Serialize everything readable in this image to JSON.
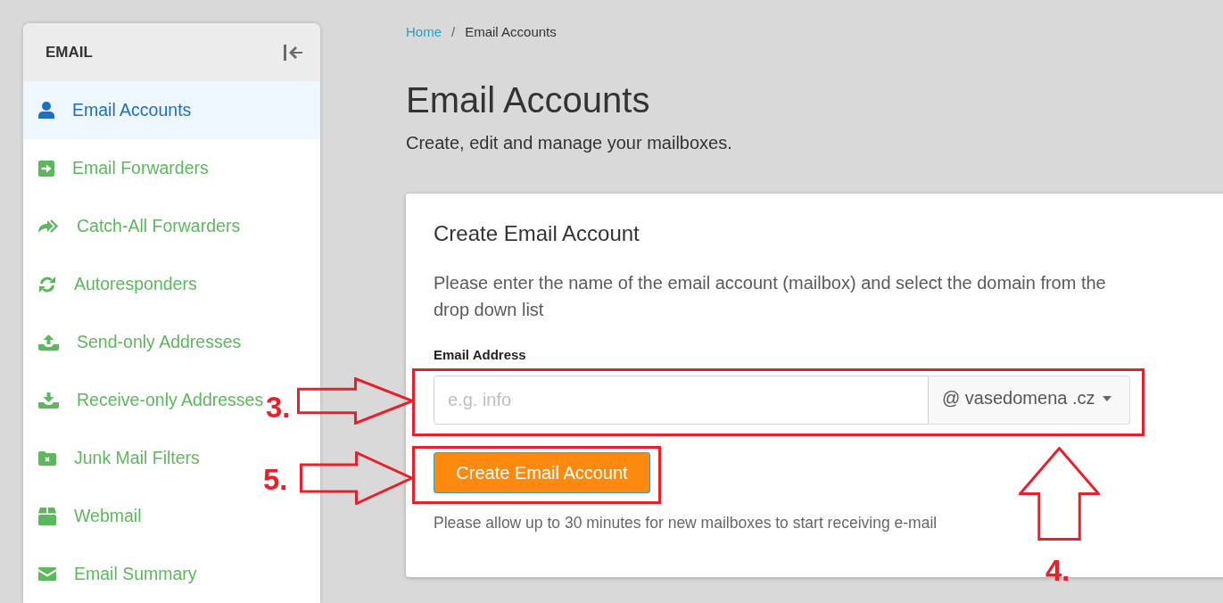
{
  "sidebar": {
    "title": "EMAIL",
    "items": [
      {
        "label": "Email Accounts",
        "selected": true,
        "kind": "user"
      },
      {
        "label": "Email Forwarders",
        "selected": false,
        "kind": "forward"
      },
      {
        "label": "Catch-All Forwarders",
        "selected": false,
        "kind": "share"
      },
      {
        "label": "Autoresponders",
        "selected": false,
        "kind": "sync"
      },
      {
        "label": "Send-only Addresses",
        "selected": false,
        "kind": "upload"
      },
      {
        "label": "Receive-only Addresses",
        "selected": false,
        "kind": "download"
      },
      {
        "label": "Junk Mail Filters",
        "selected": false,
        "kind": "junk"
      },
      {
        "label": "Webmail",
        "selected": false,
        "kind": "box"
      },
      {
        "label": "Email Summary",
        "selected": false,
        "kind": "envelope"
      }
    ]
  },
  "breadcrumb": {
    "items": [
      {
        "label": "Home",
        "kind": "link"
      },
      {
        "label": "Email Accounts",
        "kind": "current"
      }
    ],
    "separator": "/"
  },
  "page": {
    "title": "Email Accounts",
    "subtitle": "Create, edit and manage your mailboxes."
  },
  "card": {
    "title": "Create Email Account",
    "description": "Please enter the name of the email account (mailbox) and select the domain from the drop down list",
    "field": {
      "label": "Email Address",
      "placeholder": "e.g. info",
      "domain": "@ vasedomena .cz",
      "highlighted": true
    },
    "button": {
      "label": "Create Email Account",
      "highlighted": true
    },
    "note": "Please allow up to 30 minutes for new mailboxes to start receiving e-mail"
  },
  "annotations": [
    {
      "label": "3.",
      "kind": "arrow-right"
    },
    {
      "label": "4.",
      "kind": "arrow-up"
    },
    {
      "label": "5.",
      "kind": "arrow-right"
    }
  ]
}
